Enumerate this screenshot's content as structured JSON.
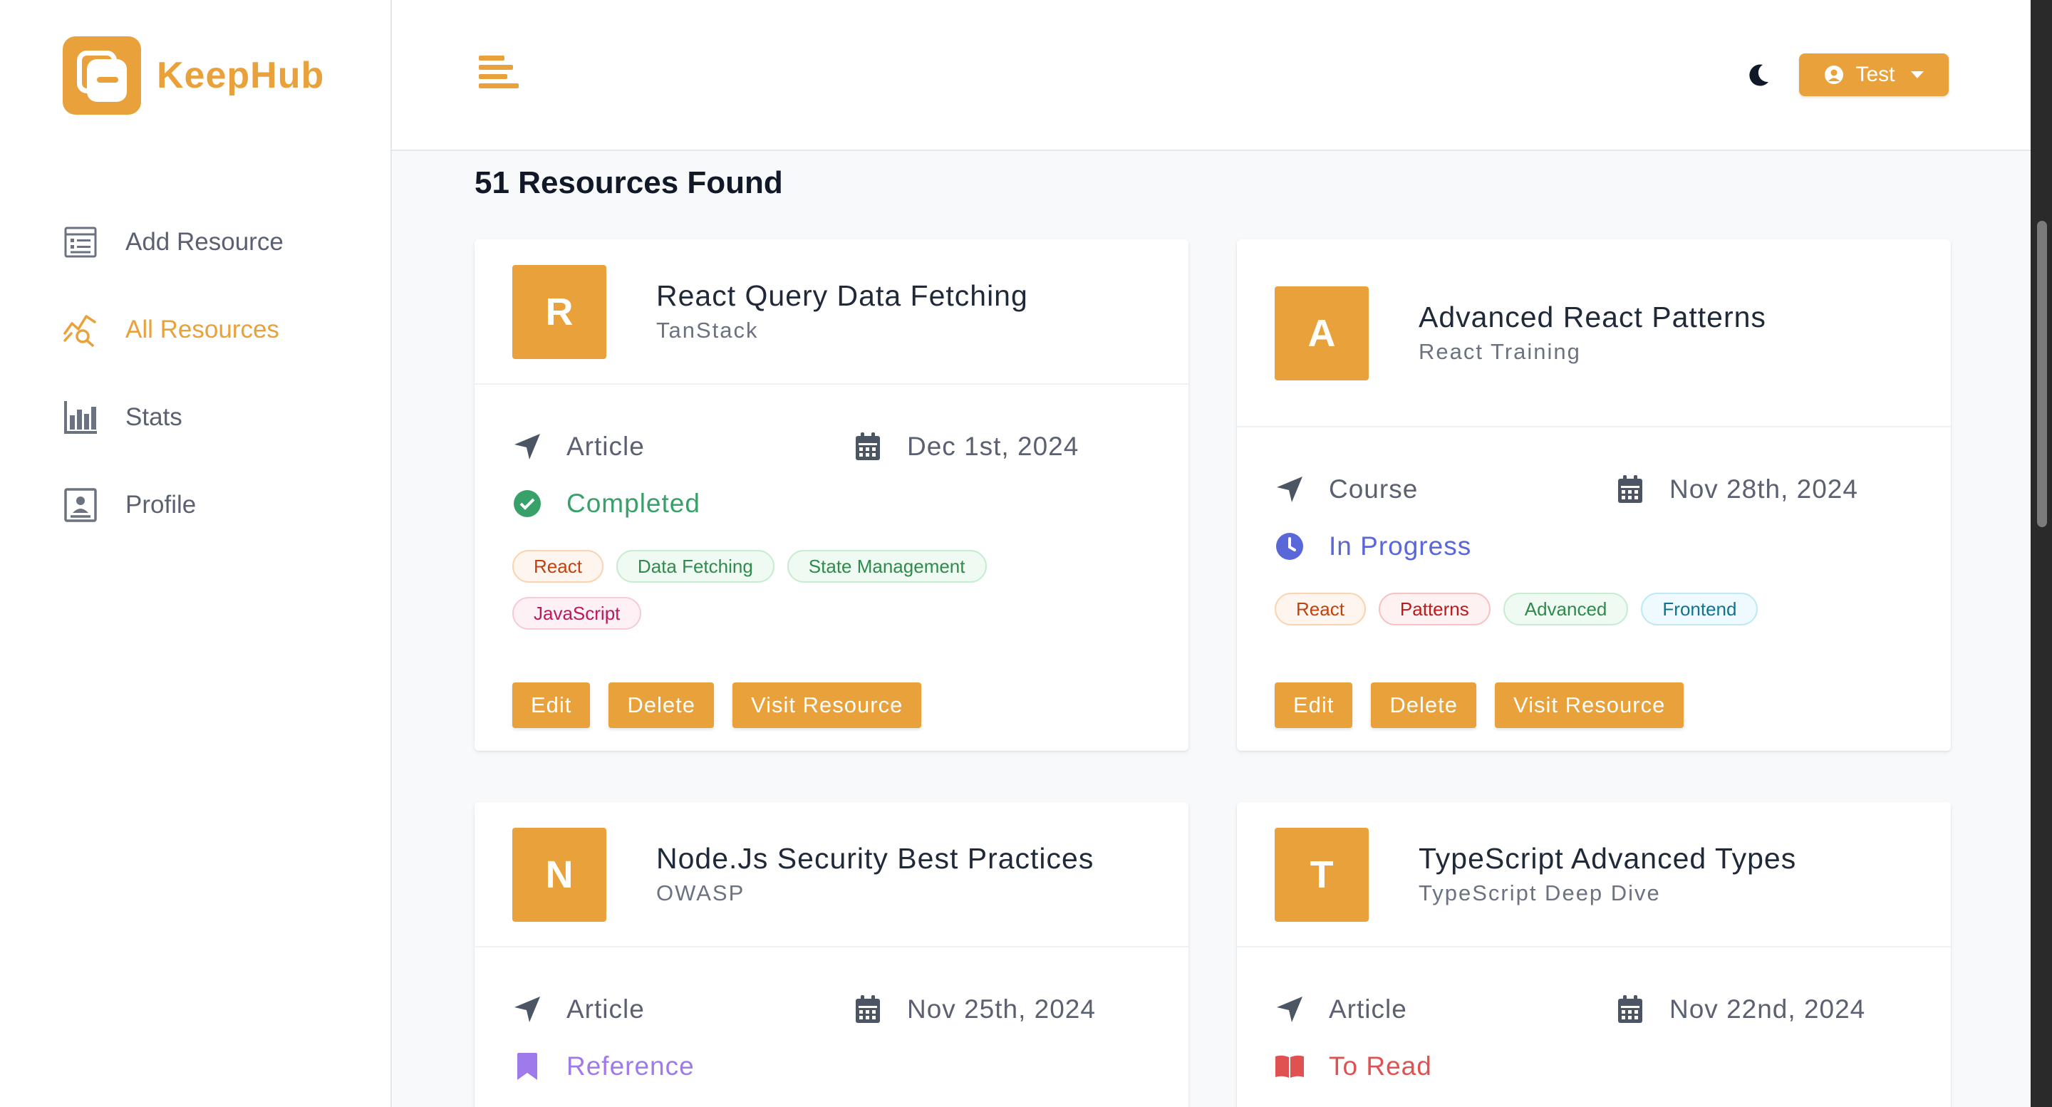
{
  "app": {
    "name": "KeepHub"
  },
  "colors": {
    "accent": "#e9a23b",
    "completed": "#38a169",
    "in_progress": "#5a67d8",
    "reference": "#9f7aea",
    "to_read": "#e05252"
  },
  "nav": [
    {
      "label": "Add Resource",
      "icon": "form-icon",
      "active": false
    },
    {
      "label": "All Resources",
      "icon": "chart-search-icon",
      "active": true
    },
    {
      "label": "Stats",
      "icon": "bar-chart-icon",
      "active": false
    },
    {
      "label": "Profile",
      "icon": "profile-card-icon",
      "active": false
    }
  ],
  "header": {
    "user_label": "Test",
    "theme_icon": "moon-icon",
    "menu_icon": "hamburger-icon"
  },
  "main": {
    "title": "51 Resources Found"
  },
  "cards": [
    {
      "letter": "R",
      "title": "React Query Data Fetching",
      "company": "TanStack",
      "type": "Article",
      "date": "Dec 1st, 2024",
      "status": "Completed",
      "tags": [
        "React",
        "Data Fetching",
        "State Management",
        "JavaScript"
      ],
      "actions": [
        "Edit",
        "Delete",
        "Visit Resource"
      ]
    },
    {
      "letter": "A",
      "title": "Advanced React Patterns",
      "company": "React Training",
      "type": "Course",
      "date": "Nov 28th, 2024",
      "status": "In Progress",
      "tags": [
        "React",
        "Patterns",
        "Advanced",
        "Frontend"
      ],
      "actions": [
        "Edit",
        "Delete",
        "Visit Resource"
      ]
    },
    {
      "letter": "N",
      "title": "Node.Js Security Best Practices",
      "company": "OWASP",
      "type": "Article",
      "date": "Nov 25th, 2024",
      "status": "Reference"
    },
    {
      "letter": "T",
      "title": "TypeScript Advanced Types",
      "company": "TypeScript Deep Dive",
      "type": "Article",
      "date": "Nov 22nd, 2024",
      "status": "To Read"
    }
  ]
}
